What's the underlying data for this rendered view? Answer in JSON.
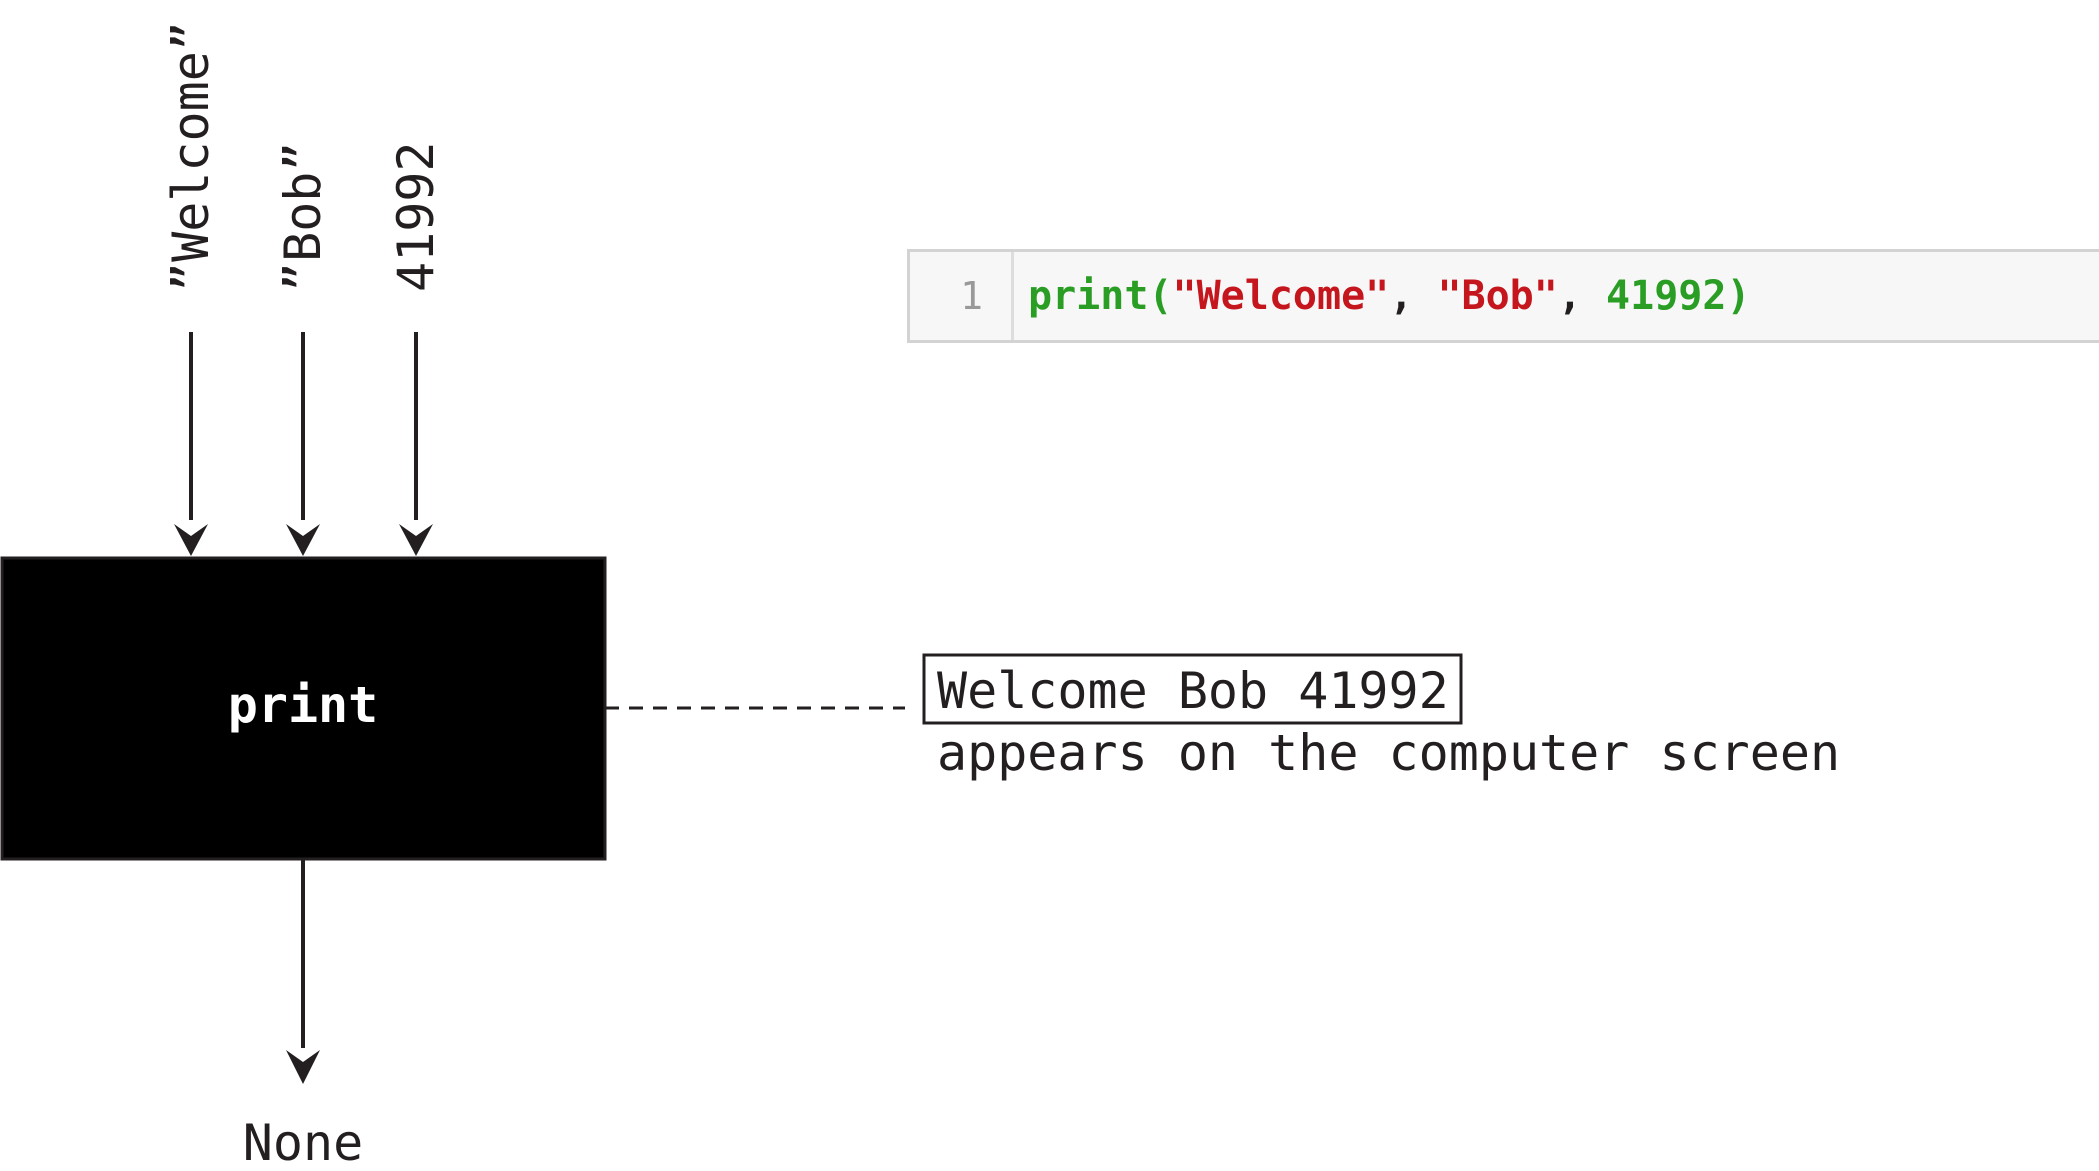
{
  "diagram": {
    "arguments": [
      "”Welcome”",
      "”Bob”",
      "41992"
    ],
    "function_name": "print",
    "return_value": "None",
    "output": {
      "printed_text": "Welcome Bob 41992",
      "caption": "appears on the computer screen"
    }
  },
  "code": {
    "line_number": "1",
    "tokens": {
      "fn": "print",
      "open": "(",
      "arg1": "\"Welcome\"",
      "sep1": ", ",
      "arg2": "\"Bob\"",
      "sep2": ", ",
      "arg3": "41992",
      "close": ")"
    }
  },
  "colors": {
    "ink": "#231f20",
    "box_fill": "#000000",
    "box_text": "#ffffff",
    "code_green": "#2a9d24",
    "code_red": "#c4161c"
  }
}
